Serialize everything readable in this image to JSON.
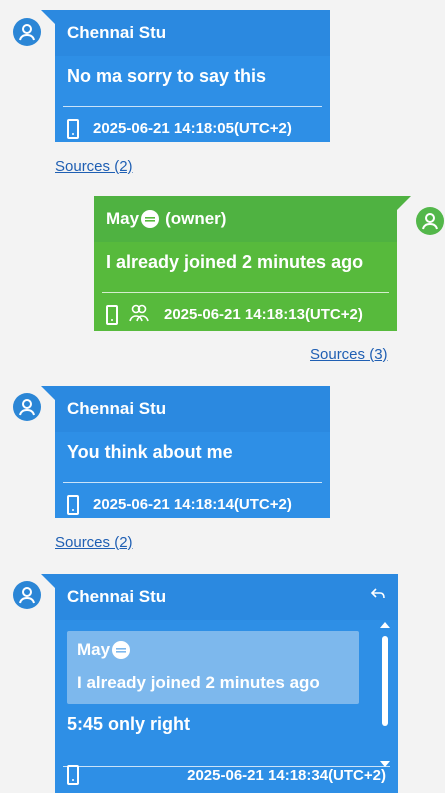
{
  "messages": [
    {
      "sender": "Chennai Stu",
      "text": "No ma sorry to say this",
      "timestamp": "2025-06-21 14:18:05(UTC+2)",
      "sources": "Sources (2)",
      "color": "#2e8fe6"
    },
    {
      "sender": "May",
      "owner_label": "(owner)",
      "text": "I already joined 2 minutes ago",
      "timestamp": "2025-06-21 14:18:13(UTC+2)",
      "sources": "Sources (3)",
      "color": "#57ba3c"
    },
    {
      "sender": "Chennai Stu",
      "text": "You think about me",
      "timestamp": "2025-06-21 14:18:14(UTC+2)",
      "sources": "Sources (2)",
      "color": "#2e8fe6"
    },
    {
      "sender": "Chennai Stu",
      "quote_sender": "May",
      "quote_text": "I already joined 2 minutes ago",
      "text": "5:45 only right",
      "timestamp": "2025-06-21 14:18:34(UTC+2)",
      "color": "#2e8fe6"
    }
  ],
  "icons": {
    "avatar": "user-avatar-icon",
    "device": "phone-icon",
    "participants": "group-icon",
    "owner": "owner-badge-icon",
    "reply": "reply-icon"
  }
}
